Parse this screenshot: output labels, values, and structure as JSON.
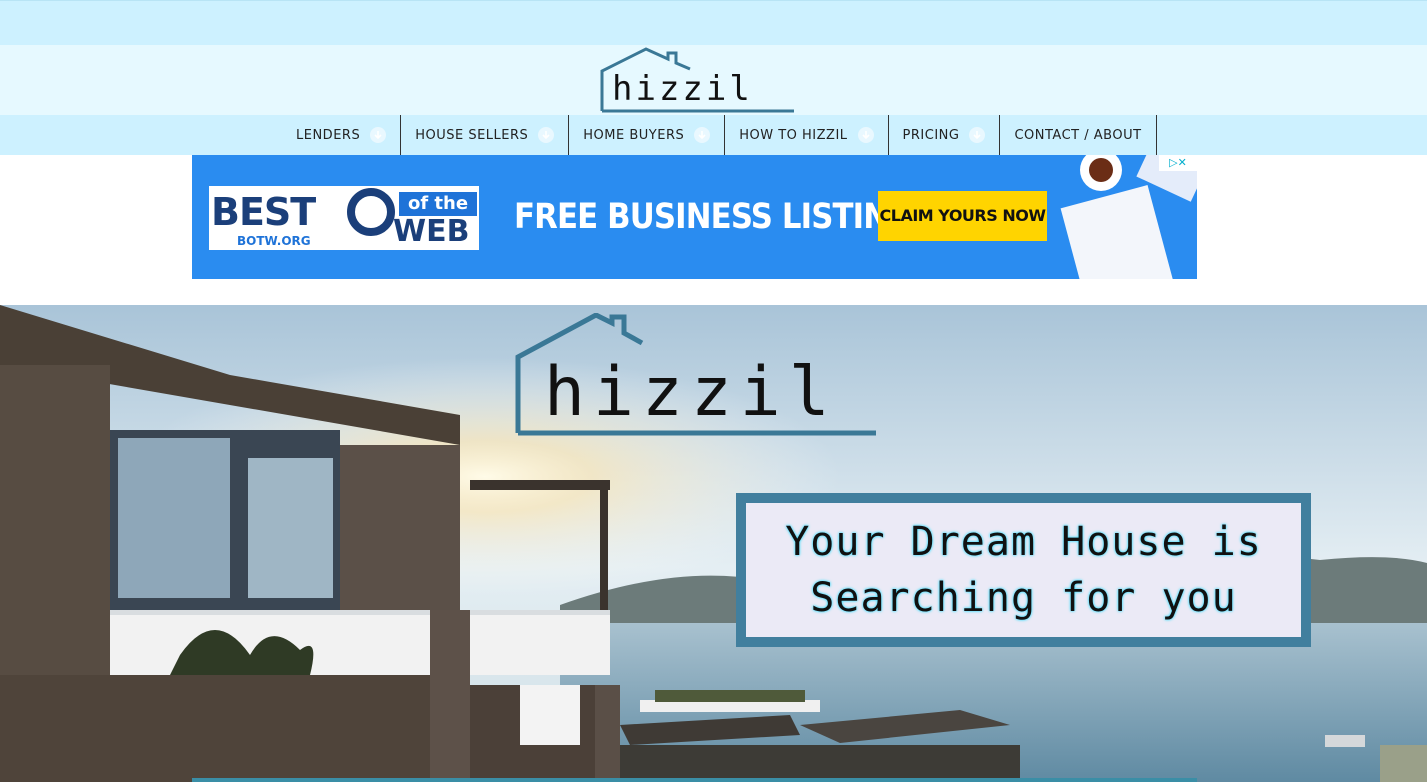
{
  "site": {
    "logo_text": "hizzil"
  },
  "nav": {
    "items": [
      {
        "label": "LENDERS",
        "has_dropdown": true
      },
      {
        "label": "HOUSE SELLERS",
        "has_dropdown": true
      },
      {
        "label": "HOME BUYERS",
        "has_dropdown": true
      },
      {
        "label": "HOW TO HIZZIL",
        "has_dropdown": true
      },
      {
        "label": "PRICING",
        "has_dropdown": true
      },
      {
        "label": "CONTACT / ABOUT",
        "has_dropdown": false
      }
    ]
  },
  "ad": {
    "brand_best": "BEST",
    "brand_ofthe": "of the",
    "brand_web": "WEB",
    "brand_url": "BOTW.ORG",
    "headline": "FREE BUSINESS LISTING",
    "cta": "CLAIM YOURS NOW",
    "badge": "▷✕"
  },
  "hero": {
    "logo_text": "hizzil",
    "tagline": [
      "Your Dream House is",
      "Searching for you"
    ]
  },
  "colors": {
    "top_strip": "#cdf1ff",
    "logo_bar": "#e6f9ff",
    "nav_bg": "#cdf1ff",
    "ad_blue": "#2a8cf0",
    "ad_cta": "#ffd400",
    "logo_house": "#3a7896",
    "tagline_frame": "#417f9e",
    "tagline_bg": "#ebeaf6"
  }
}
